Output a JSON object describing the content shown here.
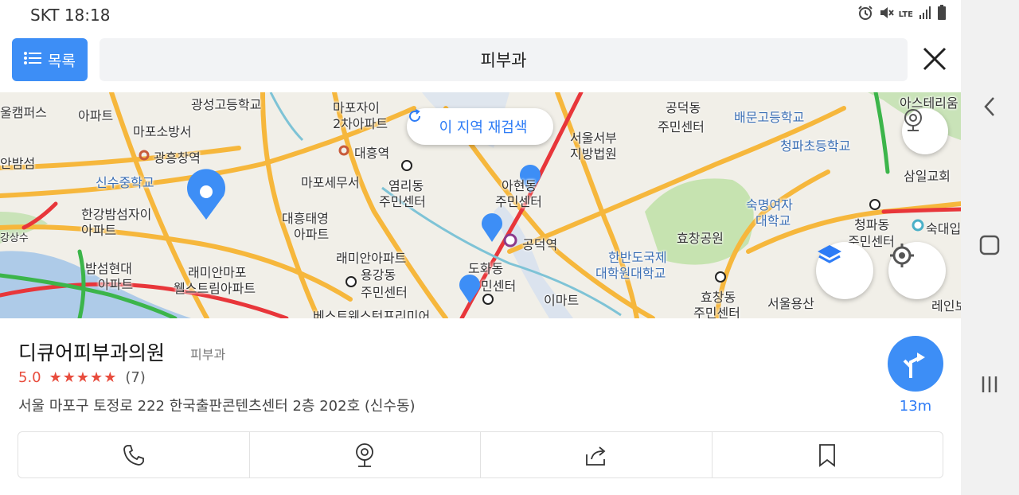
{
  "status_bar": {
    "carrier_time": "SKT 18:18",
    "network": "LTE"
  },
  "search": {
    "list_button_label": "목록",
    "query": "피부과"
  },
  "map": {
    "research_label": "이 지역 재검색",
    "labels": [
      {
        "text": "광성고등학교",
        "cls": "l1"
      },
      {
        "text": "마포자이",
        "cls": "l2"
      },
      {
        "text": "2차아파트",
        "cls": "l3"
      },
      {
        "text": "공덕동",
        "cls": "l4"
      },
      {
        "text": "주민센터",
        "cls": "l5"
      },
      {
        "text": "배문고등학교",
        "cls": "l6"
      },
      {
        "text": "마포소방서",
        "cls": "l7"
      },
      {
        "text": "광흥창역",
        "cls": "l8"
      },
      {
        "text": "대흥역",
        "cls": "l9"
      },
      {
        "text": "서울서부",
        "cls": "l10"
      },
      {
        "text": "지방법원",
        "cls": "l11"
      },
      {
        "text": "청파초등학교",
        "cls": "l12"
      },
      {
        "text": "신수중학교",
        "cls": "l13"
      },
      {
        "text": "마포세무서",
        "cls": "l14"
      },
      {
        "text": "염리동",
        "cls": "l15"
      },
      {
        "text": "주민센터",
        "cls": "l16"
      },
      {
        "text": "아현동",
        "cls": "l17"
      },
      {
        "text": "주민센터",
        "cls": "l18"
      },
      {
        "text": "삼일교회",
        "cls": "l19"
      },
      {
        "text": "숙명여자",
        "cls": "l20"
      },
      {
        "text": "대학교",
        "cls": "l21"
      },
      {
        "text": "한강밤섬자이",
        "cls": "l22"
      },
      {
        "text": "아파트",
        "cls": "l23"
      },
      {
        "text": "대흥태영",
        "cls": "l24"
      },
      {
        "text": "아파트",
        "cls": "l25"
      },
      {
        "text": "효창공원",
        "cls": "l26"
      },
      {
        "text": "청파동",
        "cls": "l27"
      },
      {
        "text": "주민센터",
        "cls": "l28"
      },
      {
        "text": "공덕역",
        "cls": "l29"
      },
      {
        "text": "래미안아파트",
        "cls": "l30"
      },
      {
        "text": "한반도국제",
        "cls": "l31"
      },
      {
        "text": "대학원대학교",
        "cls": "l32"
      },
      {
        "text": "밤섬현대",
        "cls": "l33"
      },
      {
        "text": "아파트",
        "cls": "l34"
      },
      {
        "text": "래미안마포",
        "cls": "l35"
      },
      {
        "text": "웰스트림아파트",
        "cls": "l36"
      },
      {
        "text": "용강동",
        "cls": "l37"
      },
      {
        "text": "주민센터",
        "cls": "l38"
      },
      {
        "text": "도화동",
        "cls": "l39"
      },
      {
        "text": "민센터",
        "cls": "l40"
      },
      {
        "text": "이마트",
        "cls": "l41"
      },
      {
        "text": "효창동",
        "cls": "l42"
      },
      {
        "text": "주민센터",
        "cls": "l43"
      },
      {
        "text": "서울용산",
        "cls": "l44"
      },
      {
        "text": "베스트웨스턴프리미어",
        "cls": "l45"
      },
      {
        "text": "숙대입",
        "cls": "l46"
      },
      {
        "text": "안밤섬",
        "cls": "l47"
      },
      {
        "text": "강상수",
        "cls": "l48"
      },
      {
        "text": "레인보",
        "cls": "l49"
      },
      {
        "text": "아스테리움",
        "cls": "l50"
      },
      {
        "text": "울캠퍼스",
        "cls": "l51"
      },
      {
        "text": "아파트",
        "cls": "l52"
      }
    ]
  },
  "place": {
    "name": "디큐어피부과의원",
    "category": "피부과",
    "score": "5.0",
    "stars": "★★★★★",
    "review_count": "(7)",
    "address": "서울 마포구 토정로 222 한국출판콘텐츠센터 2층 202호 (신수동)",
    "distance": "13m"
  },
  "colors": {
    "accent": "#3d8ef6",
    "rating": "#e84c3d",
    "road_major": "#f6b73c",
    "traffic_red": "#e8363a",
    "traffic_green": "#3cb54a"
  }
}
